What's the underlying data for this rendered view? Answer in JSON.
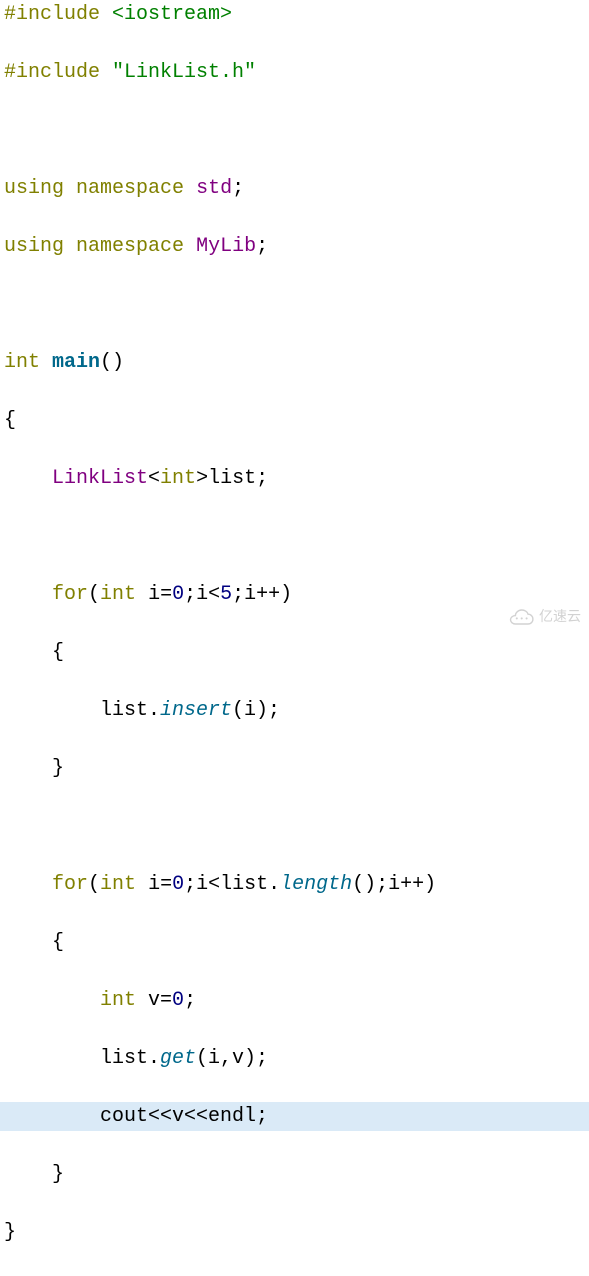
{
  "code": {
    "lines": [
      {
        "tokens": [
          {
            "t": "#include",
            "c": "preproc"
          },
          {
            "t": " ",
            "c": "plain"
          },
          {
            "t": "<iostream>",
            "c": "include-angle"
          }
        ]
      },
      {
        "tokens": [
          {
            "t": "#include",
            "c": "preproc"
          },
          {
            "t": " ",
            "c": "plain"
          },
          {
            "t": "\"LinkList.h\"",
            "c": "include-quote"
          }
        ]
      },
      {
        "tokens": []
      },
      {
        "tokens": [
          {
            "t": "using",
            "c": "keyword"
          },
          {
            "t": " ",
            "c": "plain"
          },
          {
            "t": "namespace",
            "c": "keyword"
          },
          {
            "t": " ",
            "c": "plain"
          },
          {
            "t": "std",
            "c": "namespace-std"
          },
          {
            "t": ";",
            "c": "plain"
          }
        ]
      },
      {
        "tokens": [
          {
            "t": "using",
            "c": "keyword"
          },
          {
            "t": " ",
            "c": "plain"
          },
          {
            "t": "namespace",
            "c": "keyword"
          },
          {
            "t": " ",
            "c": "plain"
          },
          {
            "t": "MyLib",
            "c": "namespace-mylib"
          },
          {
            "t": ";",
            "c": "plain"
          }
        ]
      },
      {
        "tokens": []
      },
      {
        "tokens": [
          {
            "t": "int",
            "c": "builtin-type"
          },
          {
            "t": " ",
            "c": "plain"
          },
          {
            "t": "main",
            "c": "func-main"
          },
          {
            "t": "()",
            "c": "plain"
          }
        ]
      },
      {
        "tokens": [
          {
            "t": "{",
            "c": "plain"
          }
        ]
      },
      {
        "tokens": [
          {
            "t": "    ",
            "c": "plain"
          },
          {
            "t": "LinkList",
            "c": "identifier-type"
          },
          {
            "t": "<",
            "c": "plain"
          },
          {
            "t": "int",
            "c": "builtin-type"
          },
          {
            "t": ">list;",
            "c": "plain"
          }
        ]
      },
      {
        "tokens": []
      },
      {
        "tokens": [
          {
            "t": "    ",
            "c": "plain"
          },
          {
            "t": "for",
            "c": "keyword"
          },
          {
            "t": "(",
            "c": "plain"
          },
          {
            "t": "int",
            "c": "builtin-type"
          },
          {
            "t": " i=",
            "c": "plain"
          },
          {
            "t": "0",
            "c": "number"
          },
          {
            "t": ";i<",
            "c": "plain"
          },
          {
            "t": "5",
            "c": "number"
          },
          {
            "t": ";i++)",
            "c": "plain"
          }
        ]
      },
      {
        "tokens": [
          {
            "t": "    {",
            "c": "plain"
          }
        ]
      },
      {
        "tokens": [
          {
            "t": "        list.",
            "c": "plain"
          },
          {
            "t": "insert",
            "c": "member-italic"
          },
          {
            "t": "(i);",
            "c": "plain"
          }
        ]
      },
      {
        "tokens": [
          {
            "t": "    }",
            "c": "plain"
          }
        ]
      },
      {
        "tokens": []
      },
      {
        "tokens": [
          {
            "t": "    ",
            "c": "plain"
          },
          {
            "t": "for",
            "c": "keyword"
          },
          {
            "t": "(",
            "c": "plain"
          },
          {
            "t": "int",
            "c": "builtin-type"
          },
          {
            "t": " i=",
            "c": "plain"
          },
          {
            "t": "0",
            "c": "number"
          },
          {
            "t": ";i<list.",
            "c": "plain"
          },
          {
            "t": "length",
            "c": "member-italic"
          },
          {
            "t": "();i++)",
            "c": "plain"
          }
        ]
      },
      {
        "tokens": [
          {
            "t": "    {",
            "c": "plain"
          }
        ]
      },
      {
        "tokens": [
          {
            "t": "        ",
            "c": "plain"
          },
          {
            "t": "int",
            "c": "builtin-type"
          },
          {
            "t": " v=",
            "c": "plain"
          },
          {
            "t": "0",
            "c": "number"
          },
          {
            "t": ";",
            "c": "plain"
          }
        ]
      },
      {
        "tokens": [
          {
            "t": "        list.",
            "c": "plain"
          },
          {
            "t": "get",
            "c": "member-italic"
          },
          {
            "t": "(i,v);",
            "c": "plain"
          }
        ]
      },
      {
        "highlighted": true,
        "tokens": [
          {
            "t": "        cout<<v<<endl;",
            "c": "plain"
          }
        ]
      },
      {
        "tokens": [
          {
            "t": "    }",
            "c": "plain"
          }
        ]
      },
      {
        "tokens": [
          {
            "t": "}",
            "c": "plain"
          }
        ]
      }
    ]
  },
  "watermark": {
    "text": "亿速云"
  }
}
